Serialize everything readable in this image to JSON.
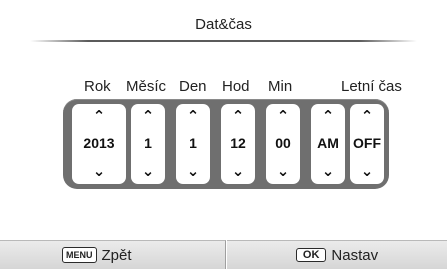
{
  "title": "Dat&čas",
  "labels": {
    "year": "Rok",
    "month": "Měsíc",
    "day": "Den",
    "hour": "Hod",
    "minute": "Min",
    "dst": "Letní čas"
  },
  "spinners": {
    "year": "2013",
    "month": "1",
    "day": "1",
    "hour": "12",
    "minute": "00",
    "ampm": "AM",
    "dst": "OFF"
  },
  "arrows": {
    "up": "⌃",
    "down": "⌃"
  },
  "footer": {
    "back_key": "MENU",
    "back_label": "Zpět",
    "set_key": "OK",
    "set_label": "Nastav"
  }
}
